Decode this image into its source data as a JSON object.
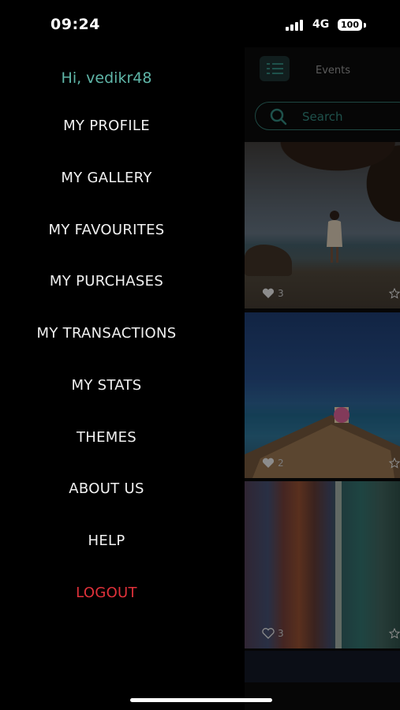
{
  "status_bar": {
    "time": "09:24",
    "network": "4G",
    "battery": "100"
  },
  "drawer": {
    "greeting": "Hi, vedikr48",
    "items": [
      {
        "label": "MY PROFILE"
      },
      {
        "label": "MY GALLERY"
      },
      {
        "label": "MY FAVOURITES"
      },
      {
        "label": "MY PURCHASES"
      },
      {
        "label": "MY TRANSACTIONS"
      },
      {
        "label": "MY STATS"
      },
      {
        "label": "THEMES"
      },
      {
        "label": "ABOUT US"
      },
      {
        "label": "HELP"
      },
      {
        "label": "LOGOUT"
      }
    ]
  },
  "main": {
    "view_toggle_icon": "list-icon",
    "events_label": "Events",
    "search": {
      "placeholder": "Search",
      "icon": "search-icon"
    },
    "cards": [
      {
        "likes": "3"
      },
      {
        "likes": "2"
      },
      {
        "likes": "3"
      }
    ]
  },
  "colors": {
    "accent": "#2f7d74",
    "greeting": "#5fb6a8",
    "logout": "#e0313a",
    "background": "#000000"
  }
}
